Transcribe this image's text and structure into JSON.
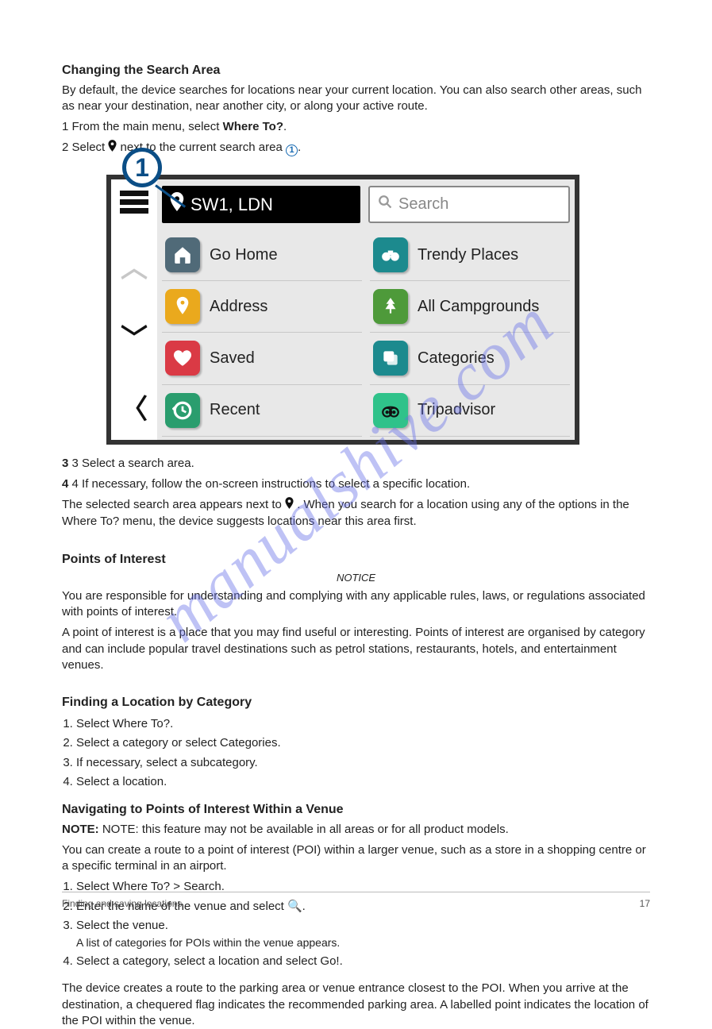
{
  "title": "Changing the Search Area",
  "intro_prefix": "By default, the device searches for locations near your current location. You can also search other areas, such as near your destination, near another city, or along your active route.",
  "step1_prefix": "1  From the main menu, select ",
  "step1_suffix": "Where To?",
  "step2_prefix": "2  Select ",
  "step2_suffix": " next to the current search area ",
  "callout_number": "1",
  "circ_number": "1",
  "device": {
    "location_label": "SW1, LDN",
    "search_placeholder": "Search",
    "items": {
      "go_home": "Go Home",
      "address": "Address",
      "saved": "Saved",
      "recent": "Recent",
      "trendy": "Trendy Places",
      "campgrounds": "All Campgrounds",
      "categories": "Categories",
      "tripadvisor": "Tripadvisor"
    }
  },
  "step3": "3  Select a search area.",
  "step4": "4  If necessary, follow the on-screen instructions to select a specific location.",
  "after_steps_prefix": "The selected search area appears next to ",
  "after_steps_suffix": ". When you search for a location using any of the options in the Where To? menu, the device suggests locations near this area first.",
  "section2_title": "Points of Interest",
  "notice_label": "NOTICE",
  "notice_text": "You are responsible for understanding and complying with any applicable rules, laws, or regulations associated with points of interest.",
  "poi_body": "A point of interest is a place that you may find useful or interesting. Points of interest are organised by category and can include popular travel destinations such as petrol stations, restaurants, hotels, and entertainment venues.",
  "section3_title": "Finding a Location by Category",
  "cat_steps": {
    "s1": "Select Where To?.",
    "s2": "Select a category or select Categories.",
    "s3": "If necessary, select a subcategory.",
    "s4": "Select a location."
  },
  "section4_title": "Navigating to Points of Interest Within a Venue",
  "section4_note": "NOTE: this feature may not be available in all areas or for all product models.",
  "section4_body": "You can create a route to a point of interest (POI) within a larger venue, such as a store in a shopping centre or a specific terminal in an airport.",
  "venue_steps": {
    "s1": "Select Where To? > Search.",
    "s2": "Enter the name of the venue and select 🔍.",
    "s3": "Select the venue.",
    "s3_note": "A list of categories for POIs within the venue appears.",
    "s4": "Select a category, select a location and select Go!."
  },
  "section4_end": "The device creates a route to the parking area or venue entrance closest to the POI. When you arrive at the destination, a chequered flag indicates the recommended parking area. A labelled point indicates the location of the POI within the venue.",
  "footer_left": "Finding and saving locations",
  "footer_right": "17",
  "watermark": "manualshive.com"
}
